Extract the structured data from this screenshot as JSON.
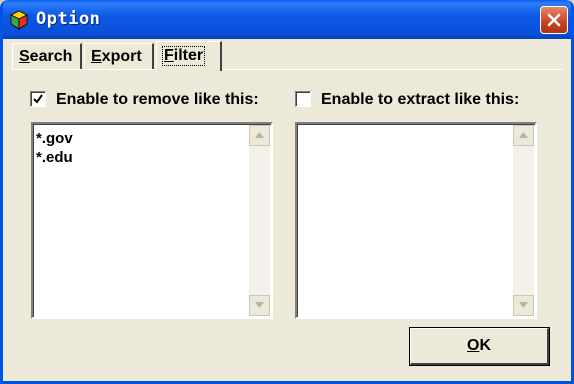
{
  "window": {
    "title": "Option",
    "icon": "app-cube-icon",
    "close_icon": "close-icon"
  },
  "tabs": [
    {
      "label": "Search",
      "mnemonic": "S",
      "rest": "earch",
      "active": false
    },
    {
      "label": "Export",
      "mnemonic": "E",
      "rest": "xport",
      "active": false
    },
    {
      "label": "Filter",
      "mnemonic": "F",
      "rest": "ilter",
      "active": true
    }
  ],
  "filter": {
    "remove": {
      "label": "Enable to remove like this:",
      "checked": true,
      "items": [
        "*.gov",
        "*.edu"
      ]
    },
    "extract": {
      "label": "Enable to extract like this:",
      "checked": false,
      "items": []
    }
  },
  "buttons": {
    "ok": {
      "label": "OK",
      "mnemonic": "O",
      "rest": "K"
    }
  },
  "colors": {
    "titlebar": "#0a4fd8",
    "close": "#c8421e",
    "face": "#ece9d8"
  }
}
